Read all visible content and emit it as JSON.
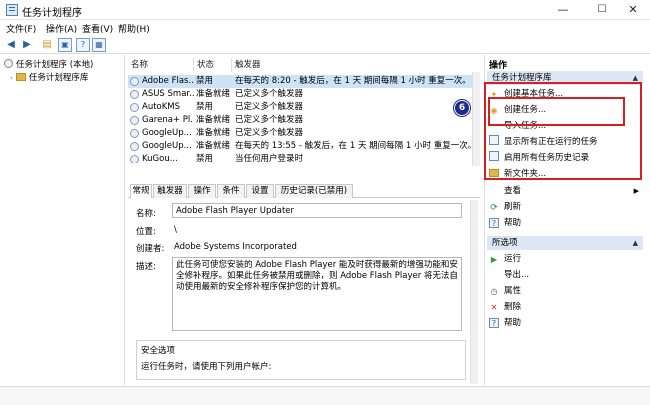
{
  "window": {
    "title": "任务计划程序",
    "min": "—",
    "max": "☐",
    "close": "✕"
  },
  "menu": [
    "文件(F)",
    "操作(A)",
    "查看(V)",
    "帮助(H)"
  ],
  "tree": {
    "root": "任务计划程序 (本地)",
    "child": "任务计划程序库"
  },
  "columns": [
    "名称",
    "状态",
    "触发器"
  ],
  "tasks": [
    {
      "name": "Adobe Flas...",
      "status": "禁用",
      "trigger": "在每天的 8:20 - 触发后，在 1 天 期间每隔 1 小时 重复一次。"
    },
    {
      "name": "ASUS Smar...",
      "status": "准备就绪",
      "trigger": "已定义多个触发器"
    },
    {
      "name": "AutoKMS",
      "status": "禁用",
      "trigger": "已定义多个触发器"
    },
    {
      "name": "Garena+ Pl...",
      "status": "准备就绪",
      "trigger": "已定义多个触发器"
    },
    {
      "name": "GoogleUp...",
      "status": "准备就绪",
      "trigger": "已定义多个触发器"
    },
    {
      "name": "GoogleUp...",
      "status": "准备就绪",
      "trigger": "在每天的 13:55 - 触发后，在 1 天 期间每隔 1 小时 重复一次。"
    },
    {
      "name": "KuGou...",
      "status": "禁用",
      "trigger": "当任何用户登录时"
    }
  ],
  "detail_tabs": [
    "常规",
    "触发器",
    "操作",
    "条件",
    "设置",
    "历史记录(已禁用)"
  ],
  "detail": {
    "name_label": "名称:",
    "name": "Adobe Flash Player Updater",
    "location_label": "位置:",
    "location": "\\",
    "author_label": "创建者:",
    "author": "Adobe Systems Incorporated",
    "desc_label": "描述:",
    "desc": "此任务可使您安装的 Adobe Flash Player 能及时获得最新的增强功能和安全修补程序。如果此任务被禁用或删除，则 Adobe Flash Player 将无法自动使用最新的安全修补程序保护您的计算机。",
    "security_header": "安全选项",
    "run_as": "运行任务时，请使用下列用户帐户:"
  },
  "actions": {
    "header": "操作",
    "section1": "任务计划程序库",
    "items1": [
      "创建基本任务...",
      "创建任务...",
      "导入任务...",
      "显示所有正在运行的任务",
      "启用所有任务历史记录",
      "新文件夹...",
      "查看",
      "刷新",
      "帮助"
    ],
    "section2": "所选项",
    "items2": [
      "运行",
      "导出...",
      "属性",
      "删除",
      "帮助"
    ]
  },
  "annotation": {
    "step": "6"
  },
  "colors": {
    "highlight": "#d42020",
    "selected_row": "#cde3f7",
    "section_bg": "#dce6f4",
    "badge": "#1d2a8e"
  }
}
